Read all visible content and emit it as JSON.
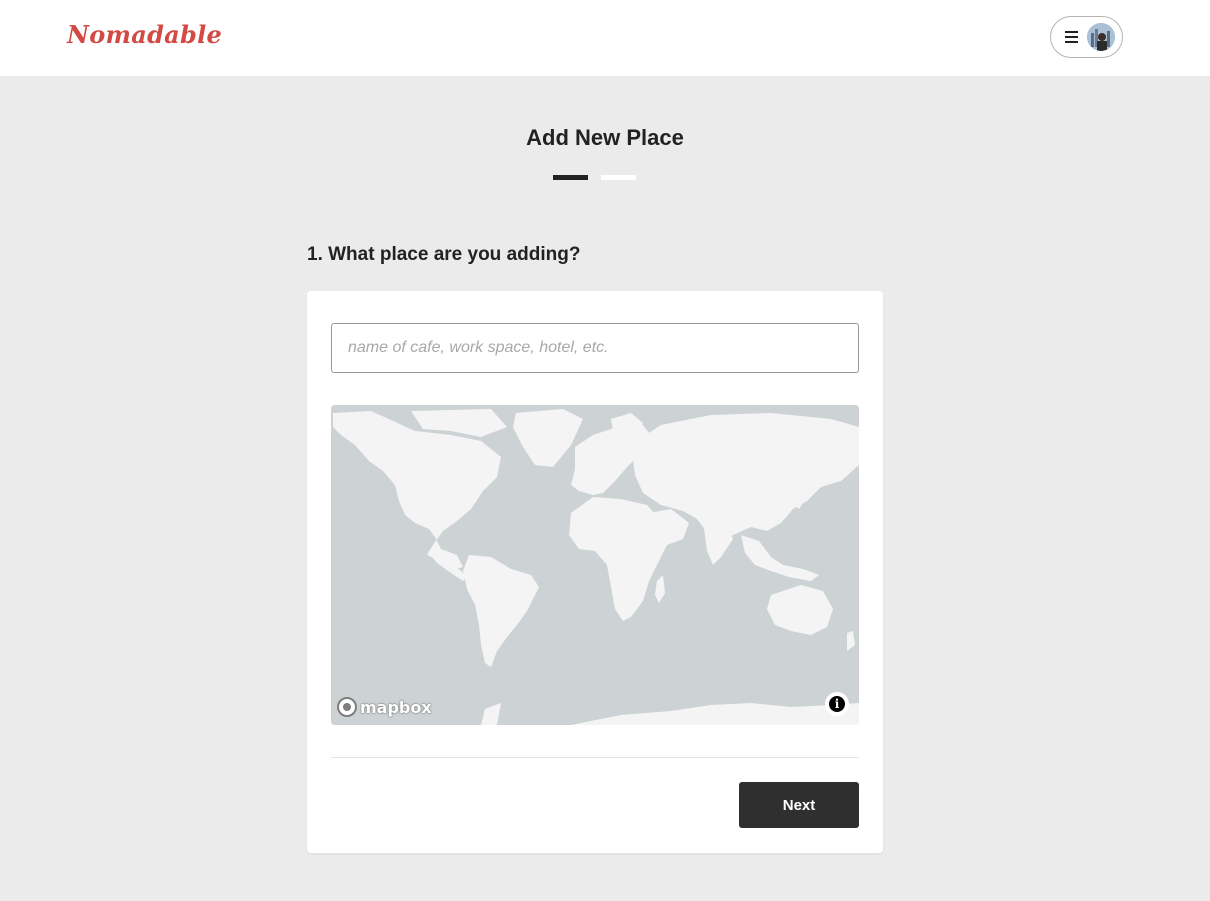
{
  "header": {
    "logo_text": "Nomadable",
    "menu_icon": "hamburger-icon",
    "avatar_icon": "user-avatar"
  },
  "main": {
    "title": "Add New Place",
    "steps": {
      "total": 2,
      "current": 1
    },
    "question": "1. What place are you adding?"
  },
  "form": {
    "place_input": {
      "value": "",
      "placeholder": "name of cafe, work space, hotel, etc."
    },
    "map": {
      "attribution_logo": "mapbox",
      "info_icon": "info-icon"
    },
    "next_label": "Next"
  },
  "colors": {
    "brand": "#d24a43",
    "page_background": "#ebebeb",
    "button": "#2f2f2f",
    "map_water": "#cdd3d4",
    "map_land": "#f4f4f4"
  }
}
